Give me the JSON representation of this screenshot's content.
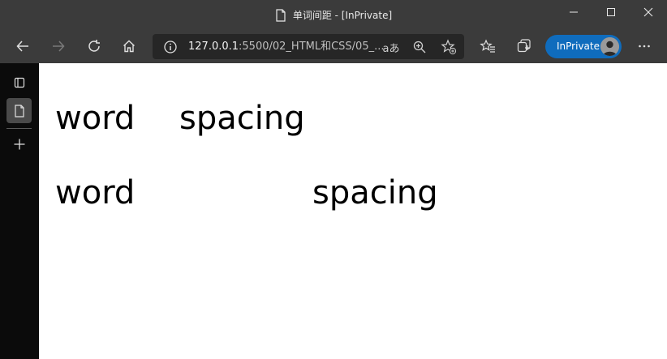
{
  "window": {
    "title": "单词间距 - [InPrivate]"
  },
  "toolbar": {
    "address": {
      "host": "127.0.0.1",
      "path": ":5500/02_HTML和CSS/05_..."
    },
    "read_aloud_label": "aあ",
    "inprivate_label": "InPrivate"
  },
  "content": {
    "lines": [
      {
        "word1": "word",
        "word2": "spacing"
      },
      {
        "word1": "word",
        "word2": "spacing"
      }
    ]
  },
  "colors": {
    "titlebar": "#3b3b3b",
    "sidebar": "#0b0b0b",
    "inprivate_badge": "#0f6cbd",
    "page_background": "#ffffff"
  }
}
